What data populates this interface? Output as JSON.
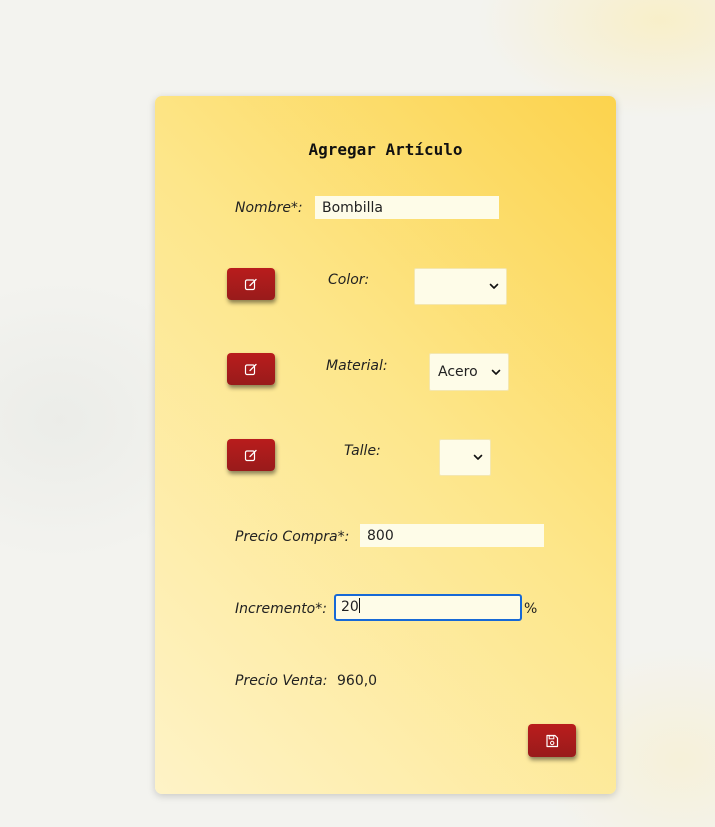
{
  "form": {
    "title": "Agregar Artículo",
    "nombre": {
      "label": "Nombre*:",
      "value": "Bombilla"
    },
    "color": {
      "label": "Color:",
      "selected": ""
    },
    "material": {
      "label": "Material:",
      "selected": "Acero"
    },
    "talle": {
      "label": "Talle:",
      "selected": ""
    },
    "precio_compra": {
      "label": "Precio Compra*:",
      "value": "800"
    },
    "incremento": {
      "label": "Incremento*:",
      "value": "20",
      "unit": "%"
    },
    "precio_venta": {
      "label": "Precio Venta:",
      "value": "960,0"
    }
  },
  "icons": {
    "edit": "edit-icon",
    "save": "save-icon",
    "dropdown": "chevron-down-icon"
  },
  "colors": {
    "accent_button": "#a51d1d",
    "card_gradient_top": "#fcd34d",
    "card_gradient_bottom": "#fef3c7",
    "input_bg": "#fefce8",
    "focus_border": "#1769d6"
  }
}
